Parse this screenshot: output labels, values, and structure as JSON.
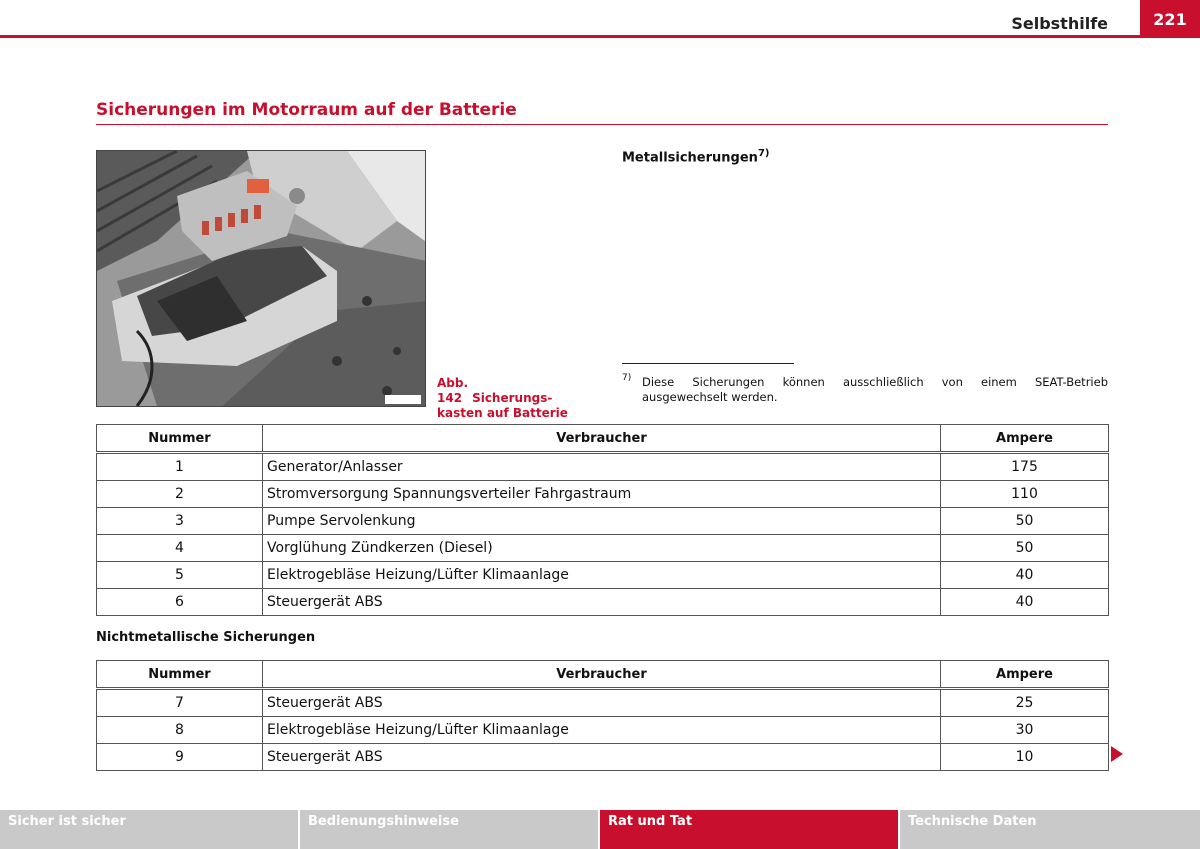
{
  "header": {
    "section": "Selbsthilfe",
    "page": "221",
    "accent": "#c8102e"
  },
  "section_title": "Sicherungen im Motorraum auf der Batterie",
  "figure": {
    "caption_num": "Abb. 142",
    "caption_text": "Sicherungs- kasten auf Batterie",
    "photo_code": "B6L-0049"
  },
  "metal": {
    "title": "Metallsicherungen",
    "sup": "7)"
  },
  "footnote": {
    "mark": "7)",
    "text": "Diese Sicherungen können ausschließlich von einem SEAT-Betrieb ausgewechselt werden."
  },
  "table1": {
    "headers": [
      "Nummer",
      "Verbraucher",
      "Ampere"
    ],
    "rows": [
      [
        "1",
        "Generator/Anlasser",
        "175"
      ],
      [
        "2",
        "Stromversorgung Spannungsverteiler Fahrgastraum",
        "110"
      ],
      [
        "3",
        "Pumpe Servolenkung",
        "50"
      ],
      [
        "4",
        "Vorglühung Zündkerzen (Diesel)",
        "50"
      ],
      [
        "5",
        "Elektrogebläse Heizung/Lüfter Klimaanlage",
        "40"
      ],
      [
        "6",
        " Steuergerät ABS",
        "40"
      ]
    ]
  },
  "nonmetal_title": "Nichtmetallische Sicherungen",
  "table2": {
    "headers": [
      "Nummer",
      "Verbraucher",
      "Ampere"
    ],
    "rows": [
      [
        "7",
        "Steuergerät ABS",
        "25"
      ],
      [
        "8",
        "Elektrogebläse Heizung/Lüfter Klimaanlage",
        "30"
      ],
      [
        "9",
        "Steuergerät ABS",
        "10"
      ]
    ]
  },
  "next_icon": "triangle-right-icon",
  "footer_tabs": [
    {
      "label": "Sicher ist sicher",
      "active": false
    },
    {
      "label": "Bedienungshinweise",
      "active": false
    },
    {
      "label": "Rat und Tat",
      "active": true
    },
    {
      "label": "Technische Daten",
      "active": false
    }
  ]
}
